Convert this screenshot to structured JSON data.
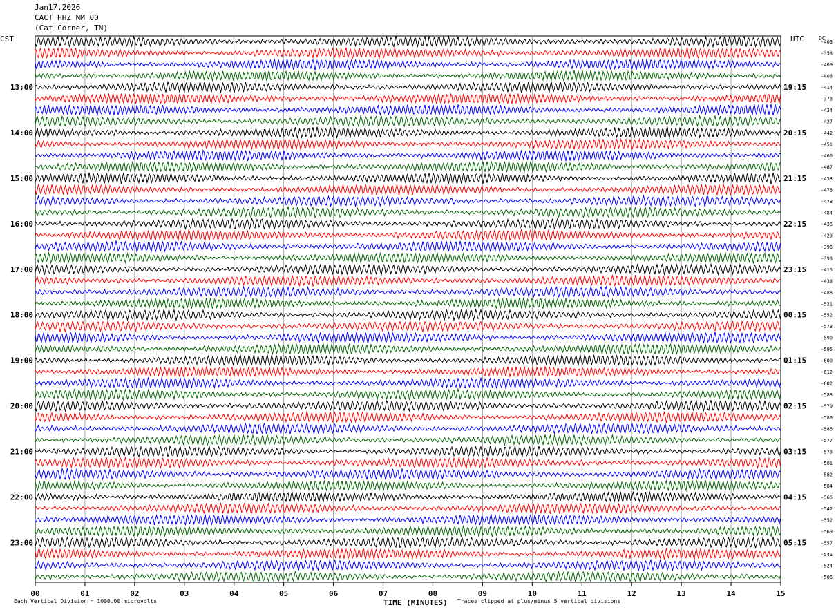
{
  "header": {
    "date": "Jan17,2026",
    "station": "CACT HHZ NM 00",
    "location": "(Cat Corner, TN)"
  },
  "left_zone": "CST",
  "right_zone": "UTC",
  "dc_label": "DC",
  "footer": {
    "scale_note": "Each Vertical Division = 1000.00 microvolts",
    "clip_note": "Traces clipped at plus/minus 5 vertical divisions"
  },
  "colors": {
    "trace_cycle": [
      "#000000",
      "#ff0000",
      "#0000ff",
      "#006400"
    ],
    "background": "#ffffff",
    "grid": "#999999"
  },
  "chart_data": {
    "type": "line",
    "title": "",
    "xlabel": "TIME (MINUTES)",
    "x_ticks": [
      "00",
      "01",
      "02",
      "03",
      "04",
      "05",
      "06",
      "07",
      "08",
      "09",
      "10",
      "11",
      "12",
      "13",
      "14",
      "15"
    ],
    "xlim": [
      0,
      15
    ],
    "left_hour_labels": [
      "13:00",
      "14:00",
      "15:00",
      "16:00",
      "17:00",
      "18:00",
      "19:00",
      "20:00",
      "21:00",
      "22:00",
      "23:00"
    ],
    "right_hour_labels": [
      "19:15",
      "20:15",
      "21:15",
      "22:15",
      "23:15",
      "00:15",
      "01:15",
      "02:15",
      "03:15",
      "04:15",
      "05:15"
    ],
    "traces_per_hour": 4,
    "dc_offsets": [
      -403,
      -358,
      -409,
      -408,
      -414,
      -373,
      -434,
      -427,
      -442,
      -451,
      -460,
      -467,
      -458,
      -476,
      -478,
      -484,
      -436,
      -429,
      -396,
      -398,
      -416,
      -438,
      -488,
      -521,
      -552,
      -573,
      -590,
      -595,
      -600,
      -612,
      -602,
      -588,
      -579,
      -580,
      -586,
      -577,
      -573,
      -581,
      -582,
      -584,
      -565,
      -542,
      -552,
      -569,
      -557,
      -541,
      -524,
      -506
    ],
    "grid": true
  }
}
